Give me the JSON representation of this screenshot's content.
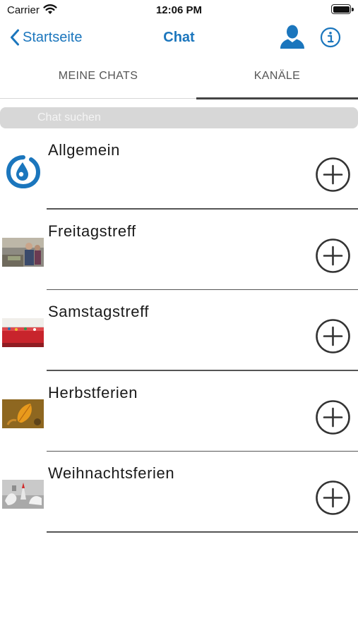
{
  "status_bar": {
    "carrier": "Carrier",
    "time": "12:06 PM",
    "battery_level": 1.0
  },
  "nav": {
    "back_label": "Startseite",
    "title": "Chat",
    "accent_color": "#1b76bd"
  },
  "tabs": [
    {
      "label": "MEINE CHATS",
      "selected": false
    },
    {
      "label": "KANÄLE",
      "selected": true
    }
  ],
  "search": {
    "placeholder": "Chat suchen",
    "value": ""
  },
  "channels": [
    {
      "name": "Allgemein",
      "thumbnail": "logo-image",
      "action_icon": "plus-circle-icon"
    },
    {
      "name": "Freitagstreff",
      "thumbnail": "photo-people",
      "action_icon": "plus-circle-icon"
    },
    {
      "name": "Samstagstreff",
      "thumbnail": "photo-red-table",
      "action_icon": "plus-circle-icon"
    },
    {
      "name": "Herbstferien",
      "thumbnail": "photo-autumn-leaf",
      "action_icon": "plus-circle-icon"
    },
    {
      "name": "Weihnachtsferien",
      "thumbnail": "photo-winter",
      "action_icon": "plus-circle-icon"
    }
  ]
}
